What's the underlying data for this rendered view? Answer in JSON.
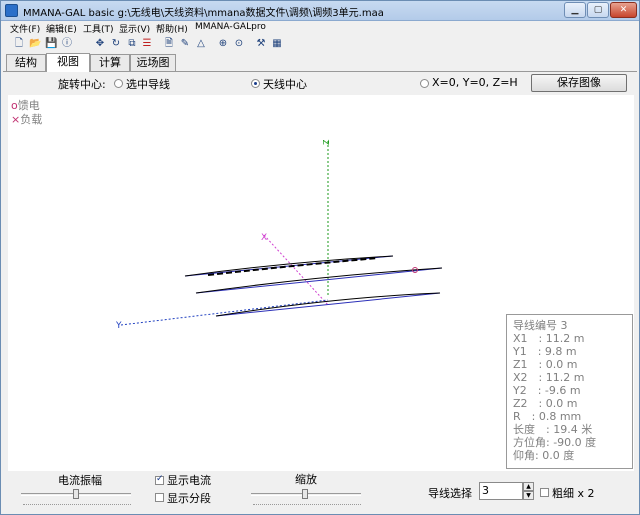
{
  "window": {
    "title": "MMANA-GAL basic g:\\无线电\\天线资料\\mmana数据文件\\调频\\调频3单元.maa"
  },
  "menu": [
    "文件(F)",
    "编辑(E)",
    "工具(T)",
    "显示(V)",
    "帮助(H)",
    "MMANA-GALpro"
  ],
  "toolbar_icons": [
    "new-icon",
    "open-icon",
    "save-icon",
    "info-icon",
    "move-icon",
    "rotate-icon",
    "copy-icon",
    "list-icon",
    "page-icon",
    "edit-icon",
    "triangle-icon",
    "target-icon",
    "tools-icon",
    "calculator-icon"
  ],
  "tabs": [
    "结构",
    "视图",
    "计算",
    "远场图"
  ],
  "rotation": {
    "label": "旋转中心:",
    "opt1": "选中导线",
    "opt2": "天线中心",
    "opt3": "X=0, Y=0, Z=H",
    "selected": "天线中心"
  },
  "save_image_label": "保存图像",
  "legend": {
    "feed": "馈电",
    "load": "负载",
    "feed_mark": "o",
    "load_mark": "×"
  },
  "axes": {
    "z": "Z",
    "x": "X",
    "y": "Y"
  },
  "wire_info": {
    "wire_no": "导线编号 3",
    "x1": "X1　:  11.2 m",
    "y1": "Y1　:  9.8 m",
    "z1": "Z1　:  0.0 m",
    "x2": "X2　:  11.2 m",
    "y2": "Y2　:  -9.6 m",
    "z2": "Z2　:  0.0 m",
    "r": "R　:  0.8 mm",
    "length": "长度　:  19.4 米",
    "azimuth": "方位角:  -90.0 度",
    "elevation": "仰角:  0.0 度"
  },
  "bottom": {
    "current_amp_label": "电流振幅",
    "show_current": "显示电流",
    "show_segments": "显示分段",
    "show_current_checked": true,
    "show_segments_checked": false,
    "zoom_label": "缩放",
    "wire_select_label": "导线选择",
    "wire_select_value": "3",
    "thick_label": "粗细 x 2",
    "thick_checked": false
  },
  "colors": {
    "titlebar": "#b9cfea",
    "wire": "#2b2fb8",
    "current": "#000000",
    "z_axis": "#1a9a1a",
    "x_axis": "#d040d0",
    "y_axis": "#2040c0",
    "feed": "#c03070"
  }
}
